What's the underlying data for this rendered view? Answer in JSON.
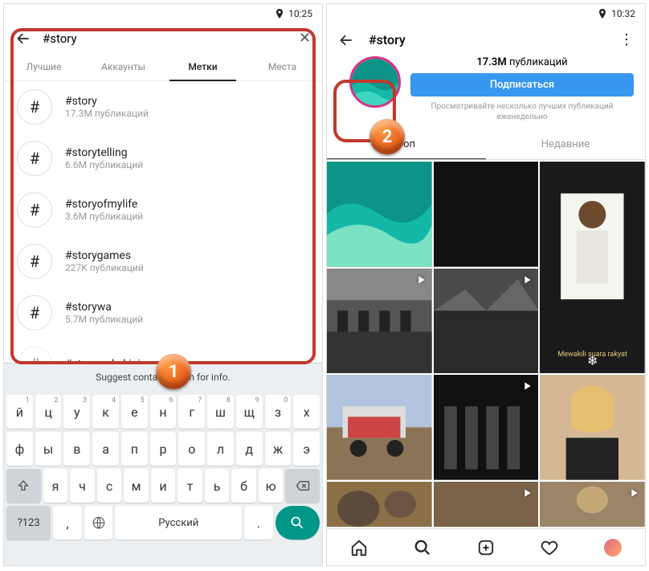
{
  "screen1": {
    "status": {
      "time": "10:25"
    },
    "search": {
      "value": "#story"
    },
    "tabs": [
      "Лучшие",
      "Аккаунты",
      "Метки",
      "Места"
    ],
    "active_tab_index": 2,
    "results": [
      {
        "tag": "#story",
        "count": "17.3M публикаций"
      },
      {
        "tag": "#storytelling",
        "count": "6.6M публикаций"
      },
      {
        "tag": "#storyofmylife",
        "count": "3.6M публикаций"
      },
      {
        "tag": "#storygames",
        "count": "227K публикаций"
      },
      {
        "tag": "#storywa",
        "count": "5.7M публикаций"
      },
      {
        "tag": "#storywakekinian",
        "count": ""
      }
    ],
    "suggest_text": "Suggest contact           Touch for info.",
    "keyboard": {
      "row1": [
        "й",
        "ц",
        "у",
        "к",
        "е",
        "н",
        "г",
        "ш",
        "щ",
        "з",
        "х"
      ],
      "row1_sup": [
        "1",
        "2",
        "3",
        "4",
        "5",
        "6",
        "7",
        "8",
        "9",
        "0",
        ""
      ],
      "row2": [
        "ф",
        "ы",
        "в",
        "а",
        "п",
        "р",
        "о",
        "л",
        "д",
        "ж",
        "э"
      ],
      "row3": [
        "я",
        "ч",
        "с",
        "м",
        "и",
        "т",
        "ь",
        "б",
        "ю"
      ],
      "num_label": "?123",
      "space_label": "Русский"
    }
  },
  "screen2": {
    "status": {
      "time": "10:32"
    },
    "title": "#story",
    "pub_count": "17.3M",
    "pub_label": "публикаций",
    "subscribe_label": "Подписаться",
    "sub_desc": "Просматривайте несколько лучших публикаций еженедельно",
    "tabs": [
      "Топ",
      "Недавние"
    ],
    "active_tab_index": 0,
    "grid_caption": "Mewakili suara rakyat"
  },
  "badges": {
    "one": "1",
    "two": "2"
  }
}
